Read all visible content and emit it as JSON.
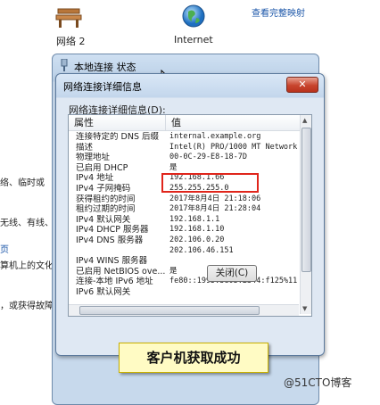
{
  "top": {
    "network_label": "网络  2",
    "internet_label": "Internet",
    "full_map_link": "查看完整映射"
  },
  "background_text": [
    "络、临时或",
    "无线、有线、",
    "页",
    "算机上的文化",
    "，或获得故障"
  ],
  "status_window": {
    "title": "本地连接 状态"
  },
  "details_window": {
    "title": "网络连接详细信息",
    "list_label": "网络连接详细信息(D):",
    "columns": [
      "属性",
      "值"
    ],
    "rows": [
      {
        "k": "连接特定的 DNS 后缀",
        "v": "internal.example.org"
      },
      {
        "k": "描述",
        "v": "Intel(R) PRO/1000 MT Network C"
      },
      {
        "k": "物理地址",
        "v": "00-0C-29-E8-18-7D"
      },
      {
        "k": "已启用 DHCP",
        "v": "是"
      },
      {
        "k": "IPv4 地址",
        "v": "192.168.1.66"
      },
      {
        "k": "IPv4 子网掩码",
        "v": "255.255.255.0"
      },
      {
        "k": "获得租约的时间",
        "v": "2017年8月4日 21:18:06"
      },
      {
        "k": "租约过期的时间",
        "v": "2017年8月4日 21:28:04"
      },
      {
        "k": "IPv4 默认网关",
        "v": "192.168.1.1"
      },
      {
        "k": "IPv4 DHCP 服务器",
        "v": "192.168.1.10"
      },
      {
        "k": "IPv4 DNS 服务器",
        "v": "202.106.0.20"
      },
      {
        "k": "",
        "v": "202.106.46.151"
      },
      {
        "k": "IPv4 WINS 服务器",
        "v": ""
      },
      {
        "k": "已启用 NetBIOS ove...",
        "v": "是"
      },
      {
        "k": "连接-本地 IPv6 地址",
        "v": "fe80::1995:3e03:2344:f125%11"
      },
      {
        "k": "IPv6 默认网关",
        "v": ""
      }
    ],
    "close_button": "关闭(C)"
  },
  "caption": "客户机获取成功",
  "watermark": "@51CTO博客"
}
